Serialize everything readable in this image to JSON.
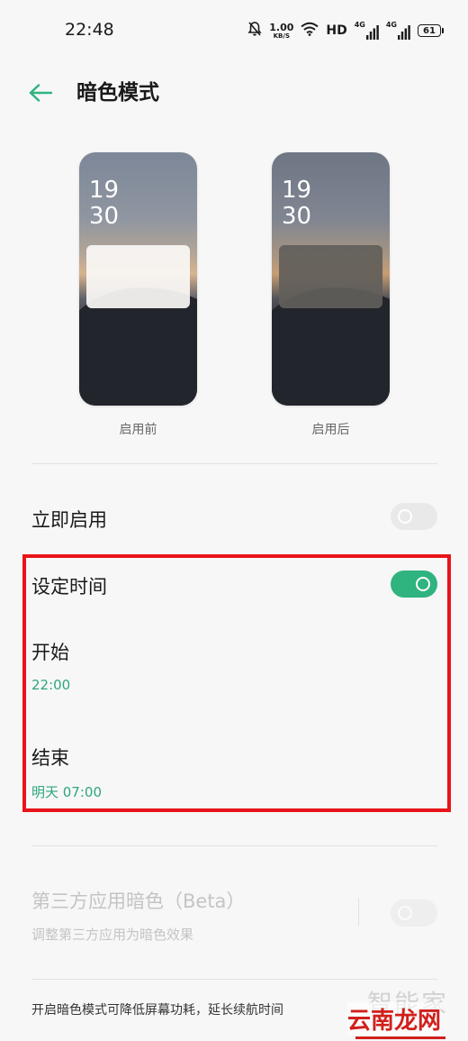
{
  "status_bar": {
    "time": "22:48",
    "net_speed_value": "1.00",
    "net_speed_unit": "KB/S",
    "hd_label": "HD",
    "network_1": "4G",
    "network_2": "4G",
    "battery": "61"
  },
  "header": {
    "title": "暗色模式"
  },
  "preview": {
    "before": {
      "clock_hour": "19",
      "clock_minute": "30",
      "caption": "启用前"
    },
    "after": {
      "clock_hour": "19",
      "clock_minute": "30",
      "caption": "启用后"
    }
  },
  "settings": {
    "enable_now": {
      "label": "立即启用",
      "enabled": false
    },
    "schedule": {
      "label": "设定时间",
      "enabled": true
    },
    "start": {
      "label": "开始",
      "value": "22:00"
    },
    "end": {
      "label": "结束",
      "value": "明天 07:00"
    },
    "third_party": {
      "label": "第三方应用暗色（Beta）",
      "sublabel": "调整第三方应用为暗色效果",
      "enabled": false,
      "disabled": true
    }
  },
  "footer": {
    "text": "开启暗色模式可降低屏幕功耗，延长续航时间"
  },
  "watermark": {
    "line1": "智能家",
    "line2": "云南龙网"
  },
  "colors": {
    "accent": "#2fb37f",
    "highlight_border": "#e8141a"
  }
}
